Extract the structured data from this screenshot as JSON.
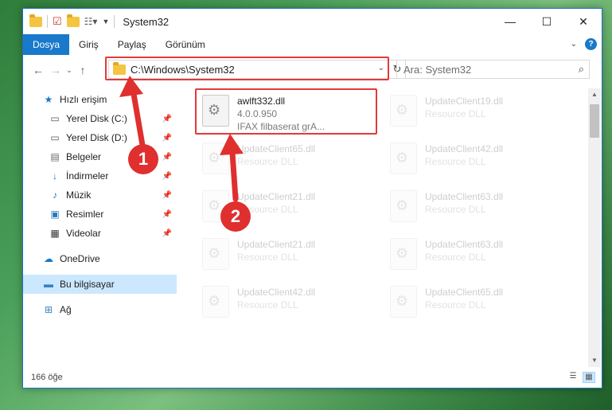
{
  "window": {
    "title": "System32",
    "controls": {
      "minimize": "—",
      "maximize": "☐",
      "close": "✕"
    }
  },
  "ribbon": {
    "tabs": [
      "Dosya",
      "Giriş",
      "Paylaş",
      "Görünüm"
    ],
    "help": "?"
  },
  "navbar": {
    "address": "C:\\Windows\\System32",
    "search_placeholder": "Ara: System32"
  },
  "sidebar": {
    "items": [
      {
        "label": "Hızlı erişim",
        "icon": "star-icon",
        "pinned": false
      },
      {
        "label": "Yerel Disk (C:)",
        "icon": "drive-icon",
        "pinned": true
      },
      {
        "label": "Yerel Disk (D:)",
        "icon": "drive-icon",
        "pinned": true
      },
      {
        "label": "Belgeler",
        "icon": "documents-icon",
        "pinned": true
      },
      {
        "label": "İndirmeler",
        "icon": "download-icon",
        "pinned": true
      },
      {
        "label": "Müzik",
        "icon": "music-icon",
        "pinned": true
      },
      {
        "label": "Resimler",
        "icon": "pictures-icon",
        "pinned": true
      },
      {
        "label": "Videolar",
        "icon": "videos-icon",
        "pinned": true
      },
      {
        "label": "OneDrive",
        "icon": "cloud-icon",
        "pinned": false
      },
      {
        "label": "Bu bilgisayar",
        "icon": "computer-icon",
        "pinned": false,
        "selected": true
      },
      {
        "label": "Ağ",
        "icon": "network-icon",
        "pinned": false
      }
    ]
  },
  "files": [
    {
      "name": "awlft332.dll",
      "line2": "4.0.0.950",
      "line3": "IFAX filbaserat grA...",
      "highlighted": true
    },
    {
      "name": "UpdateClient19.dll",
      "line2": "Resource DLL",
      "line3": ""
    },
    {
      "name": "UpdateClient65.dll",
      "line2": "Resource DLL",
      "line3": ""
    },
    {
      "name": "UpdateClient42.dll",
      "line2": "Resource DLL",
      "line3": ""
    },
    {
      "name": "UpdateClient21.dll",
      "line2": "Resource DLL",
      "line3": ""
    },
    {
      "name": "UpdateClient63.dll",
      "line2": "Resource DLL",
      "line3": ""
    },
    {
      "name": "UpdateClient21.dll",
      "line2": "Resource DLL",
      "line3": ""
    },
    {
      "name": "UpdateClient63.dll",
      "line2": "Resource DLL",
      "line3": ""
    },
    {
      "name": "UpdateClient42.dll",
      "line2": "Resource DLL",
      "line3": ""
    },
    {
      "name": "UpdateClient65.dll",
      "line2": "Resource DLL",
      "line3": ""
    }
  ],
  "status": {
    "count": "166 öğe"
  },
  "annotations": {
    "badge1": "1",
    "badge2": "2"
  },
  "colors": {
    "accent": "#1979ca",
    "highlight": "#e23a3a",
    "badge": "#e02f2f",
    "selected": "#cce8ff"
  }
}
